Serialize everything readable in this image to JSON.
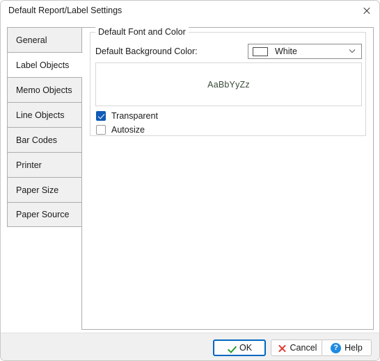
{
  "window": {
    "title": "Default Report/Label Settings",
    "close_icon": "close-icon"
  },
  "tabs": [
    {
      "label": "General",
      "selected": false
    },
    {
      "label": "Label Objects",
      "selected": true
    },
    {
      "label": "Memo Objects",
      "selected": false
    },
    {
      "label": "Line Objects",
      "selected": false
    },
    {
      "label": "Bar Codes",
      "selected": false
    },
    {
      "label": "Printer",
      "selected": false
    },
    {
      "label": "Paper Size",
      "selected": false
    },
    {
      "label": "Paper Source",
      "selected": false
    }
  ],
  "panel": {
    "group_title": "Default Font and Color",
    "background_color_label": "Default Background Color:",
    "background_color_value": "White",
    "background_color_swatch": "#ffffff",
    "dropdown_icon": "chevron-down-icon",
    "preview_sample_text": "AaBbYyZz",
    "checkboxes": [
      {
        "label": "Transparent",
        "checked": true
      },
      {
        "label": "Autosize",
        "checked": false
      }
    ]
  },
  "footer": {
    "ok_label": "OK",
    "ok_icon": "checkmark-icon",
    "cancel_label": "Cancel",
    "cancel_icon": "x-mark-icon",
    "help_label": "Help",
    "help_icon": "question-circle-icon"
  },
  "colors": {
    "accent": "#0067c0",
    "checkbox_checked": "#0f5bb5",
    "ok_check": "#26a030",
    "cancel_x": "#e03a32",
    "help_circle": "#1e8ae0"
  }
}
